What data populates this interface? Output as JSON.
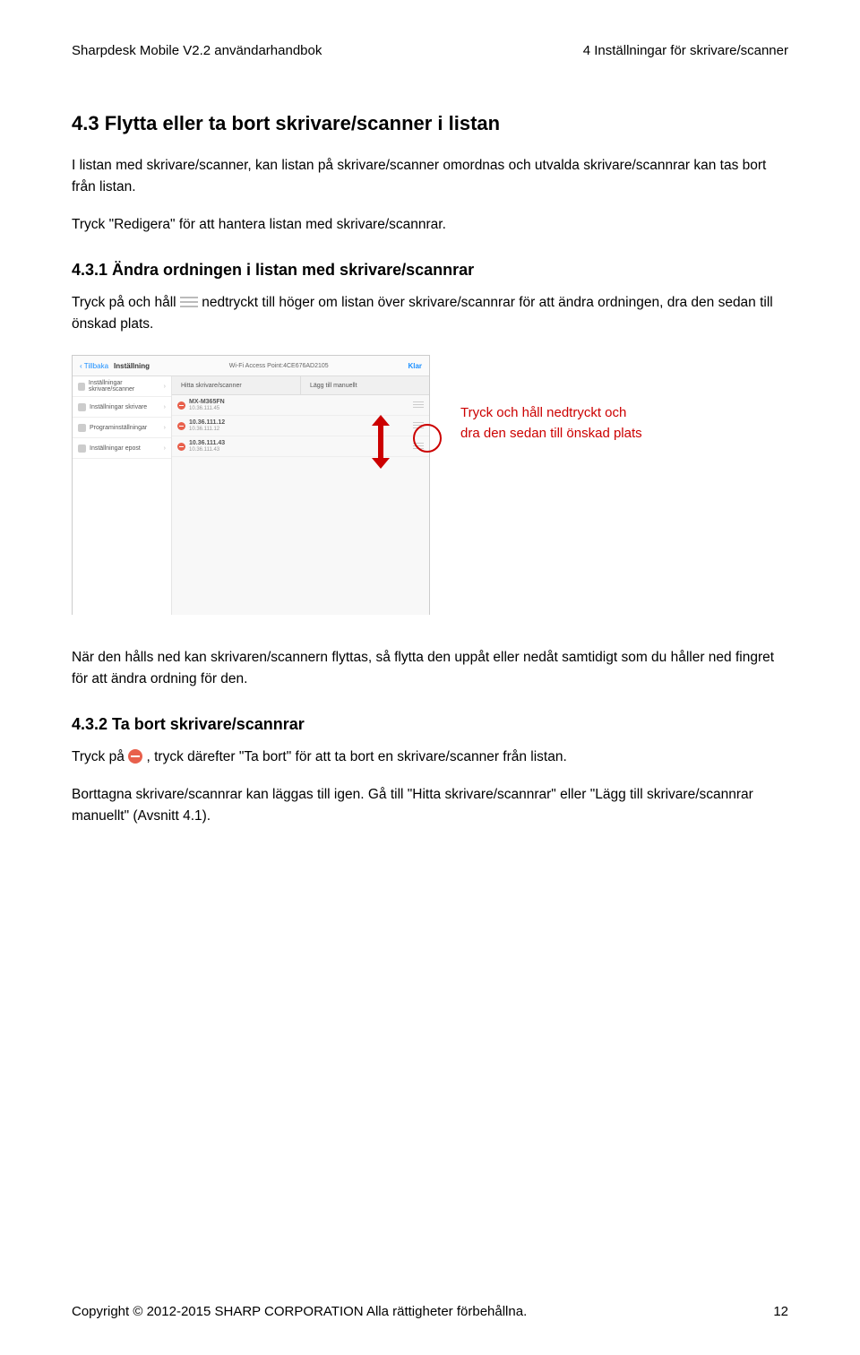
{
  "header": {
    "left": "Sharpdesk Mobile V2.2 användarhandbok",
    "right": "4 Inställningar för skrivare/scanner"
  },
  "s43": {
    "heading": "4.3   Flytta eller ta bort skrivare/scanner i listan",
    "p1": "I listan med skrivare/scanner, kan listan på skrivare/scanner omordnas och utvalda skrivare/scannrar kan tas bort från listan.",
    "p2": "Tryck \"Redigera\" för att hantera listan med skrivare/scannrar."
  },
  "s431": {
    "heading": "4.3.1   Ändra ordningen i listan med skrivare/scannrar",
    "p_before": "Tryck på och håll ",
    "p_after": " nedtryckt till höger om listan över skrivare/scannrar för att ändra ordningen, dra den sedan till önskad plats.",
    "annotation_l1": "Tryck och håll nedtryckt och",
    "annotation_l2": "dra den sedan till önskad plats",
    "p_below": "När den hålls ned kan skrivaren/scannern flyttas, så flytta den uppåt eller nedåt samtidigt som du håller ned fingret för att ändra ordning för den."
  },
  "s432": {
    "heading": "4.3.2   Ta bort skrivare/scannrar",
    "p1_before": "Tryck på ",
    "p1_after": ", tryck därefter \"Ta bort\" för att ta bort en skrivare/scanner från listan.",
    "p2": "Borttagna skrivare/scannrar kan läggas till igen. Gå till \"Hitta skrivare/scannrar\" eller \"Lägg till skrivare/scannrar manuellt\" (Avsnitt 4.1)."
  },
  "mockup": {
    "top_back": "Tillbaka",
    "top_title": "Inställning",
    "top_wifi": "Wi-Fi Access Point:4CE676AD2105",
    "top_klar": "Klar",
    "left_items": [
      "Inställningar skrivare/scanner",
      "Inställningar skrivare",
      "Programinställningar",
      "Inställningar epost"
    ],
    "mid_btn1": "Hitta skrivare/scanner",
    "mid_btn2": "Lägg till manuellt",
    "rows": [
      {
        "name": "MX-M365FN",
        "sub": "10.36.111.45"
      },
      {
        "name": "10.36.111.12",
        "sub": "10.36.111.12"
      },
      {
        "name": "10.36.111.43",
        "sub": "10.36.111.43"
      }
    ]
  },
  "footer": {
    "left": "Copyright © 2012-2015 SHARP CORPORATION Alla rättigheter förbehållna.",
    "right": "12"
  }
}
